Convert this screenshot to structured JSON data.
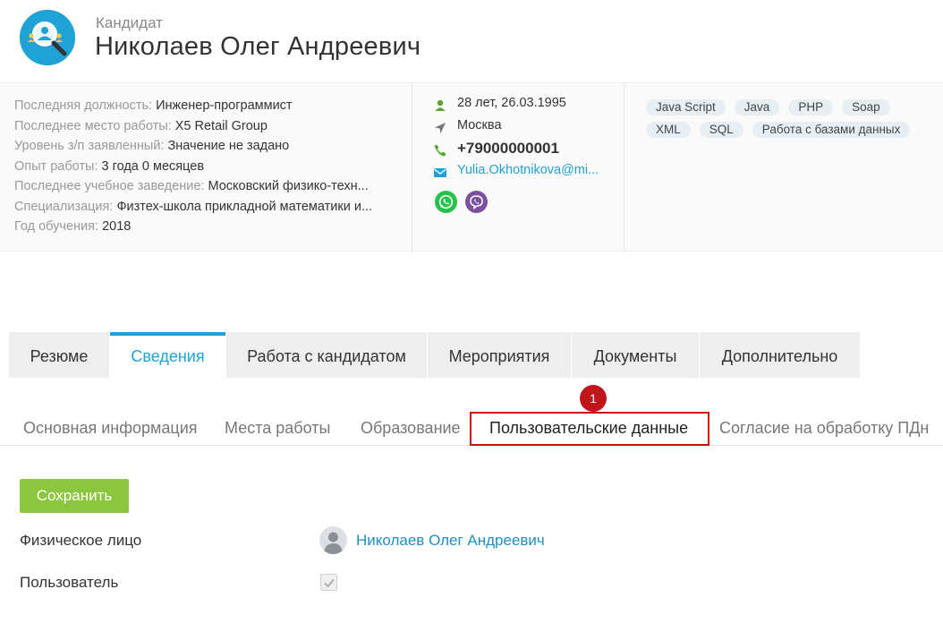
{
  "header": {
    "label": "Кандидат",
    "name": "Николаев Олег Андреевич"
  },
  "info": {
    "rows": [
      {
        "key": "Последняя должность:",
        "value": "Инженер-программист"
      },
      {
        "key": "Последнее место работы:",
        "value": "X5 Retail Group"
      },
      {
        "key": "Уровень з/п заявленный:",
        "value": "Значение не задано"
      },
      {
        "key": "Опыт работы:",
        "value": "3 года 0 месяцев"
      },
      {
        "key": "Последнее учебное заведение:",
        "value": "Московский физико-техн..."
      },
      {
        "key": "Специализация:",
        "value": "Физтех-школа прикладной математики и..."
      },
      {
        "key": "Год обучения:",
        "value": "2018"
      }
    ]
  },
  "contacts": {
    "age": "28 лет, 26.03.1995",
    "city": "Москва",
    "phone": "+79000000001",
    "email": "Yulia.Okhotnikova@mi..."
  },
  "skills": [
    "Java Script",
    "Java",
    "PHP",
    "Soap",
    "XML",
    "SQL",
    "Работа с базами данных"
  ],
  "main_tabs": [
    "Резюме",
    "Сведения",
    "Работа с кандидатом",
    "Мероприятия",
    "Документы",
    "Дополнительно"
  ],
  "sub_tabs": [
    "Основная информация",
    "Места работы",
    "Образование",
    "Пользовательские данные",
    "Согласие на обработку ПДн"
  ],
  "annotation_badge": "1",
  "form": {
    "save_label": "Сохранить",
    "physical_person_label": "Физическое лицо",
    "physical_person_value": "Николаев Олег Андреевич",
    "user_label": "Пользователь",
    "user_checked": true
  },
  "colors": {
    "accent": "#1fa3d6",
    "save_button": "#8cc63f",
    "highlight": "#d10f0f",
    "whatsapp": "#25c24c",
    "viber": "#7b519d",
    "contact_icon": "#5aa52f"
  },
  "icons": {
    "avatar": "candidate-search-icon",
    "age": "person-icon",
    "city": "location-arrow-icon",
    "phone": "phone-icon",
    "email": "envelope-icon",
    "whatsapp": "whatsapp-icon",
    "viber": "viber-icon"
  }
}
